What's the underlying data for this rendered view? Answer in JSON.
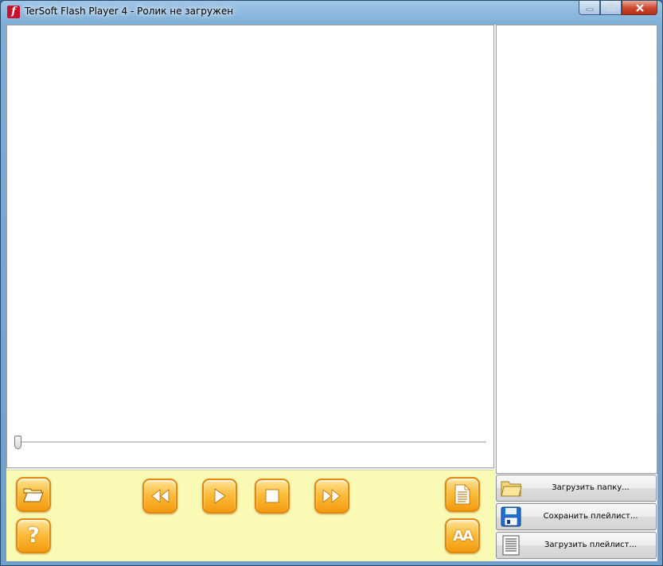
{
  "window": {
    "title": "TerSoft Flash Player 4 - Ролик не загружен",
    "app_icon_glyph": "f"
  },
  "player": {
    "seek_position": 0
  },
  "controls": {
    "open": {
      "icon": "folder-open-icon"
    },
    "help": {
      "icon": "question-mark-icon",
      "glyph": "?"
    },
    "rewind": {
      "icon": "rewind-icon"
    },
    "play": {
      "icon": "play-icon"
    },
    "stop": {
      "icon": "stop-icon"
    },
    "forward": {
      "icon": "fast-forward-icon"
    },
    "playlist_toggle": {
      "icon": "document-icon"
    },
    "font_size": {
      "icon": "font-size-icon",
      "glyph": "AA"
    }
  },
  "playlist": {
    "items": [],
    "load_folder_label": "Загрузить папку...",
    "save_playlist_label": "Сохранить плейлист...",
    "load_playlist_label": "Загрузить плейлист..."
  },
  "colors": {
    "controls_bg": "#fafab4",
    "button_orange": "#f39a10",
    "button_light": "#ffe39a"
  }
}
